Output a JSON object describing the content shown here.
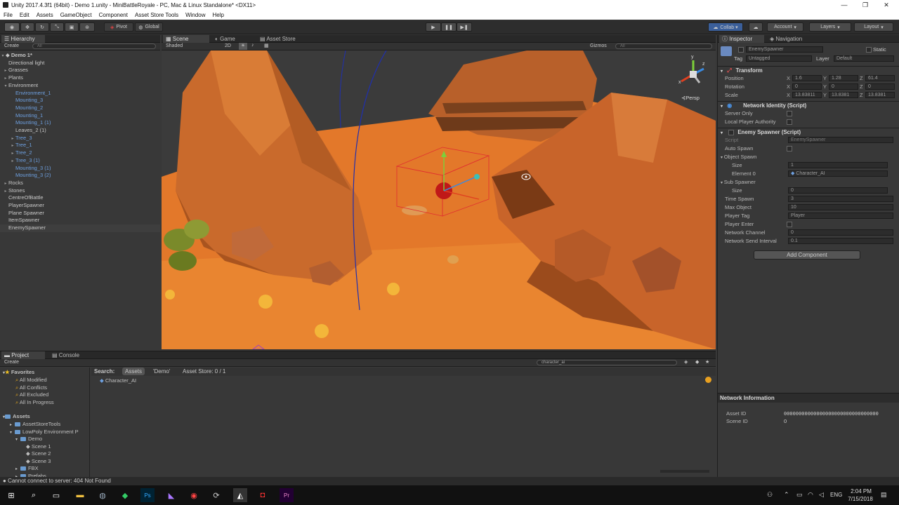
{
  "window": {
    "title": "Unity 2017.4.3f1 (64bit) - Demo 1.unity - MiniBattleRoyale - PC, Mac & Linux Standalone* <DX11>"
  },
  "menu": [
    "File",
    "Edit",
    "Assets",
    "GameObject",
    "Component",
    "Asset Store Tools",
    "Window",
    "Help"
  ],
  "toolbar": {
    "pivot": "Pivot",
    "global": "Global",
    "collab": "Collab ▾",
    "account": "Account",
    "layers": "Layers",
    "layout": "Layout"
  },
  "hierarchy": {
    "tab": "Hierarchy",
    "create": "Create",
    "search_placeholder": "All",
    "scene": "Demo 1*",
    "items": [
      {
        "label": "Directional light",
        "depth": 1,
        "arrow": false,
        "color": "white"
      },
      {
        "label": "Grasses",
        "depth": 1,
        "arrow": true,
        "color": "white"
      },
      {
        "label": "Plants",
        "depth": 1,
        "arrow": true,
        "color": "white"
      },
      {
        "label": "Environment",
        "depth": 1,
        "arrow": true,
        "open": true,
        "color": "white"
      },
      {
        "label": "Environment_1",
        "depth": 2,
        "arrow": false,
        "color": "blue"
      },
      {
        "label": "Mounting_3",
        "depth": 2,
        "arrow": false,
        "color": "blue"
      },
      {
        "label": "Mounting_2",
        "depth": 2,
        "arrow": false,
        "color": "blue"
      },
      {
        "label": "Mounting_1",
        "depth": 2,
        "arrow": false,
        "color": "blue"
      },
      {
        "label": "Mounting_1 (1)",
        "depth": 2,
        "arrow": false,
        "color": "blue"
      },
      {
        "label": "Leaves_2 (1)",
        "depth": 2,
        "arrow": false,
        "color": "white"
      },
      {
        "label": "Tree_3",
        "depth": 2,
        "arrow": true,
        "color": "blue"
      },
      {
        "label": "Tree_1",
        "depth": 2,
        "arrow": true,
        "color": "blue"
      },
      {
        "label": "Tree_2",
        "depth": 2,
        "arrow": true,
        "color": "blue"
      },
      {
        "label": "Tree_3 (1)",
        "depth": 2,
        "arrow": true,
        "color": "blue"
      },
      {
        "label": "Mounting_3 (1)",
        "depth": 2,
        "arrow": false,
        "color": "blue"
      },
      {
        "label": "Mounting_3 (2)",
        "depth": 2,
        "arrow": false,
        "color": "blue"
      },
      {
        "label": "Rocks",
        "depth": 1,
        "arrow": true,
        "color": "white"
      },
      {
        "label": "Stones",
        "depth": 1,
        "arrow": true,
        "color": "white"
      },
      {
        "label": "CentreOfBattle",
        "depth": 1,
        "arrow": false,
        "color": "white"
      },
      {
        "label": "PlayerSpawner",
        "depth": 1,
        "arrow": false,
        "color": "white"
      },
      {
        "label": "Plane Spawner",
        "depth": 1,
        "arrow": false,
        "color": "white"
      },
      {
        "label": "ItemSpawner",
        "depth": 1,
        "arrow": false,
        "color": "white"
      },
      {
        "label": "EnemySpawner",
        "depth": 1,
        "arrow": false,
        "color": "white",
        "selected": true
      }
    ]
  },
  "scene_view": {
    "tabs": [
      "Scene",
      "Game",
      "Asset Store"
    ],
    "shading": "Shaded",
    "mode_2d": "2D",
    "gizmos": "Gizmos",
    "search_placeholder": "All",
    "persp": "Persp",
    "gizmo_labels": {
      "y": "y",
      "x": "x",
      "z": "z"
    }
  },
  "inspector": {
    "tabs": [
      "Inspector",
      "Navigation"
    ],
    "object_name": "EnemySpawner",
    "static": "Static",
    "tag_label": "Tag",
    "tag": "Untagged",
    "layer_label": "Layer",
    "layer": "Default",
    "transform": {
      "title": "Transform",
      "rows": [
        {
          "label": "Position",
          "x": "1.6",
          "y": "1.28",
          "z": "61.4"
        },
        {
          "label": "Rotation",
          "x": "0",
          "y": "0",
          "z": "0"
        },
        {
          "label": "Scale",
          "x": "13.83811",
          "y": "13.8381",
          "z": "13.8381"
        }
      ]
    },
    "network_identity": {
      "title": "Network Identity (Script)",
      "server_only": "Server Only",
      "local_player_authority": "Local Player Authority"
    },
    "enemy_spawner": {
      "title": "Enemy Spawner (Script)",
      "script_label": "Script",
      "script": "EnemySpawner",
      "auto_spawn": "Auto Spawn",
      "object_spawn": "Object Spawn",
      "size_label": "Size",
      "object_size": "1",
      "element0_label": "Element 0",
      "element0": "Character_AI",
      "sub_spawner": "Sub Spawner",
      "sub_size": "0",
      "time_spawn_label": "Time Spawn",
      "time_spawn": "3",
      "max_object_label": "Max Object",
      "max_object": "10",
      "player_tag_label": "Player Tag",
      "player_tag": "Player",
      "player_enter": "Player Enter",
      "network_channel_label": "Network Channel",
      "network_channel": "0",
      "network_send_interval_label": "Network Send Interval",
      "network_send_interval": "0.1"
    },
    "add_component": "Add Component",
    "network_info": {
      "title": "Network Information",
      "asset_id_label": "Asset ID",
      "asset_id": "00000000000000000000000000000000",
      "scene_id_label": "Scene ID",
      "scene_id": "0"
    }
  },
  "project": {
    "tabs": [
      "Project",
      "Console"
    ],
    "create": "Create",
    "search_value": "character_ai",
    "search_bar": {
      "label": "Search:",
      "assets": "Assets",
      "demo": "'Demo'",
      "store": "Asset Store: 0 / 1"
    },
    "result": "Character_AI",
    "favorites": {
      "title": "Favorites",
      "items": [
        "All Modified",
        "All Conflicts",
        "All Excluded",
        "All In Progress"
      ]
    },
    "assets": {
      "title": "Assets",
      "items": [
        {
          "label": "AssetStoreTools",
          "depth": 1
        },
        {
          "label": "LowPoly Environment P",
          "depth": 1
        },
        {
          "label": "Demo",
          "depth": 2
        },
        {
          "label": "Scene 1",
          "depth": 3
        },
        {
          "label": "Scene 2",
          "depth": 3
        },
        {
          "label": "Scene 3",
          "depth": 3
        },
        {
          "label": "FBX",
          "depth": 2
        },
        {
          "label": "Prefabs",
          "depth": 2
        }
      ]
    }
  },
  "status": {
    "message": "Cannot connect to server: 404 Not Found"
  },
  "taskbar": {
    "lang": "ENG",
    "time": "2:04 PM",
    "date": "7/15/2018"
  },
  "colors": {
    "accent": "#3d6ab3",
    "sand": "#e07a2a",
    "rock": "#c8692c",
    "sky": "#3a3a3a"
  }
}
